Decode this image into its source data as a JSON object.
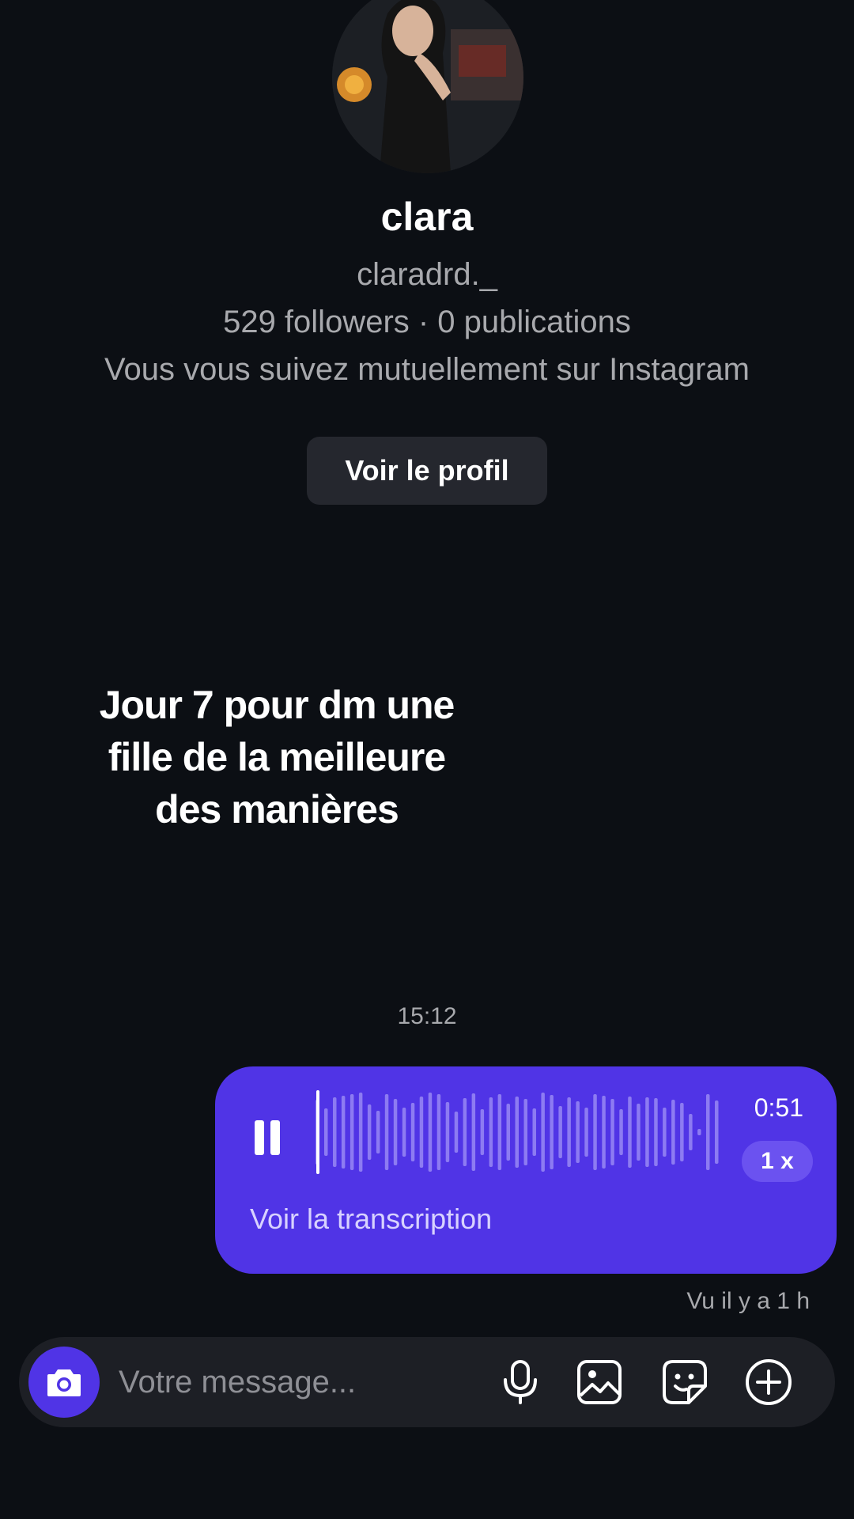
{
  "profile": {
    "name": "clara",
    "handle": "claradrd._",
    "stats": "529 followers · 0 publications",
    "mutual": "Vous vous suivez mutuellement sur Instagram",
    "view_profile_label": "Voir le profil"
  },
  "overlay": {
    "caption_line1": "Jour 7 pour dm une",
    "caption_line2": "fille de la meilleure",
    "caption_line3": "des manières"
  },
  "conversation": {
    "timestamp": "15:12",
    "voice_message": {
      "duration": "0:51",
      "speed": "1 x",
      "transcript_label": "Voir la transcription",
      "progress": 0.0,
      "accent_color": "#5034e6"
    },
    "seen_status": "Vu il y a 1 h"
  },
  "composer": {
    "placeholder": "Votre message...",
    "icons": [
      "camera-icon",
      "microphone-icon",
      "gallery-icon",
      "sticker-icon",
      "plus-circle-icon"
    ]
  }
}
